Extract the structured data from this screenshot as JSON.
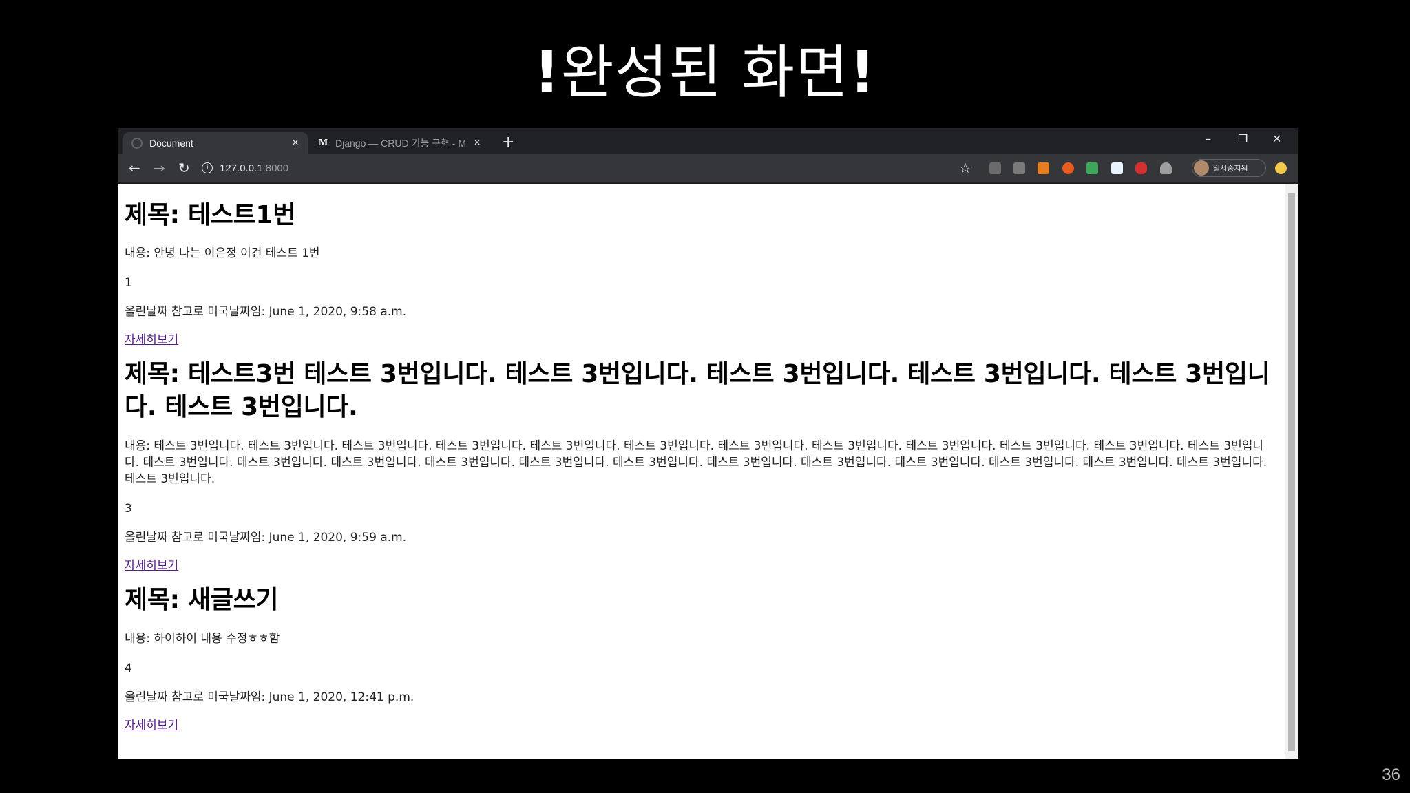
{
  "slide": {
    "title": "완성된 화면",
    "bang_left": "!",
    "bang_right": "!",
    "page_number": "36"
  },
  "browser": {
    "tabs": [
      {
        "label": "Document",
        "close": "×",
        "active": true
      },
      {
        "label": "Django — CRUD 기능 구현 - M",
        "close": "×",
        "active": false
      }
    ],
    "new_tab": "+",
    "window_controls": {
      "minimize": "–",
      "restore": "❐",
      "close": "✕"
    },
    "nav": {
      "back": "←",
      "forward": "→",
      "reload": "↻"
    },
    "address": {
      "host": "127.0.0.1",
      "port": ":8000"
    },
    "profile_label": "일시중지됨",
    "icons": [
      "info-icon",
      "star-icon",
      "extension-icons",
      "avatar-icon"
    ],
    "colors": {
      "tabbar": "#202124",
      "toolbar": "#35363a",
      "link": "#551a8b"
    }
  },
  "posts": [
    {
      "title": "제목: 테스트1번",
      "body": "내용: 안녕 나는 이은정 이건 테스트 1번",
      "number": "1",
      "date": "올린날짜 참고로 미국날짜임: June 1, 2020, 9:58 a.m.",
      "link": "자세히보기"
    },
    {
      "title": "제목: 테스트3번 테스트 3번입니다. 테스트 3번입니다. 테스트 3번입니다. 테스트 3번입니다. 테스트 3번입니다. 테스트 3번입니다.",
      "body": "내용: 테스트 3번입니다. 테스트 3번입니다. 테스트 3번입니다. 테스트 3번입니다. 테스트 3번입니다. 테스트 3번입니다. 테스트 3번입니다. 테스트 3번입니다. 테스트 3번입니다. 테스트 3번입니다. 테스트 3번입니다. 테스트 3번입니다. 테스트 3번입니다. 테스트 3번입니다. 테스트 3번입니다. 테스트 3번입니다. 테스트 3번입니다. 테스트 3번입니다. 테스트 3번입니다. 테스트 3번입니다. 테스트 3번입니다. 테스트 3번입니다. 테스트 3번입니다. 테스트 3번입니다. 테스트 3번입니다.",
      "number": "3",
      "date": "올린날짜 참고로 미국날짜임: June 1, 2020, 9:59 a.m.",
      "link": "자세히보기"
    },
    {
      "title": "제목: 새글쓰기",
      "body": "내용: 하이하이 내용 수정ㅎㅎ함",
      "number": "4",
      "date": "올린날짜 참고로 미국날짜임: June 1, 2020, 12:41 p.m.",
      "link": "자세히보기"
    }
  ]
}
